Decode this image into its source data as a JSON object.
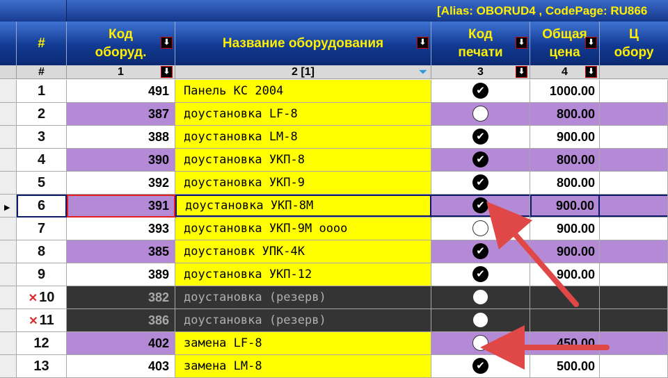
{
  "banner": {
    "title": "[Alias: OBORUD4 , CodePage: RU866"
  },
  "header": {
    "num": "#",
    "code": "Код\nоборуд.",
    "name": "Название оборудования",
    "print": "Код\nпечати",
    "price": "Общая\nцена",
    "rest": "Ц\nобору"
  },
  "subheader": {
    "num": "#",
    "code": "1",
    "name": "2 [1]",
    "print": "3",
    "price": "4"
  },
  "icons": {
    "sort": "sort-down-icon",
    "filter": "filter-funnel-icon",
    "check": "check-circle-icon",
    "empty": "empty-circle-icon",
    "deleted": "deleted-x-icon"
  },
  "colors": {
    "yellow": "#ffff00",
    "purple": "#b48ad6",
    "dark": "#343434",
    "header": "#123a92",
    "header_text": "#ffef00",
    "arrow": "#e04848"
  },
  "rows": [
    {
      "num": "1",
      "code": "491",
      "name": "Панель КС 2004",
      "checked": true,
      "price": "1000.00",
      "bg": "w"
    },
    {
      "num": "2",
      "code": "387",
      "name": "доустановка LF-8",
      "checked": false,
      "price": "800.00",
      "bg": "p"
    },
    {
      "num": "3",
      "code": "388",
      "name": "доустановка LM-8",
      "checked": true,
      "price": "900.00",
      "bg": "w"
    },
    {
      "num": "4",
      "code": "390",
      "name": "доустановка УКП-8",
      "checked": true,
      "price": "800.00",
      "bg": "p"
    },
    {
      "num": "5",
      "code": "392",
      "name": "доустановка УКП-9",
      "checked": true,
      "price": "800.00",
      "bg": "w"
    },
    {
      "num": "6",
      "code": "391",
      "name": "доустановка УКП-8М",
      "checked": true,
      "price": "900.00",
      "bg": "p",
      "selected": true
    },
    {
      "num": "7",
      "code": "393",
      "name": "доустановка УКП-9М оооо",
      "checked": false,
      "price": "900.00",
      "bg": "w"
    },
    {
      "num": "8",
      "code": "385",
      "name": "доустановк УПК-4К",
      "checked": true,
      "price": "900.00",
      "bg": "p"
    },
    {
      "num": "9",
      "code": "389",
      "name": "доустановка УКП-12",
      "checked": true,
      "price": "900.00",
      "bg": "w"
    },
    {
      "num": "10",
      "code": "382",
      "name": "доустановка (резерв)",
      "checked": false,
      "price": "",
      "bg": "d",
      "deleted": true
    },
    {
      "num": "11",
      "code": "386",
      "name": "доустановка (резерв)",
      "checked": false,
      "price": "",
      "bg": "d",
      "deleted": true
    },
    {
      "num": "12",
      "code": "402",
      "name": "замена LF-8",
      "checked": false,
      "price": "450.00",
      "bg": "p"
    },
    {
      "num": "13",
      "code": "403",
      "name": "замена LM-8",
      "checked": true,
      "price": "500.00",
      "bg": "w"
    }
  ]
}
